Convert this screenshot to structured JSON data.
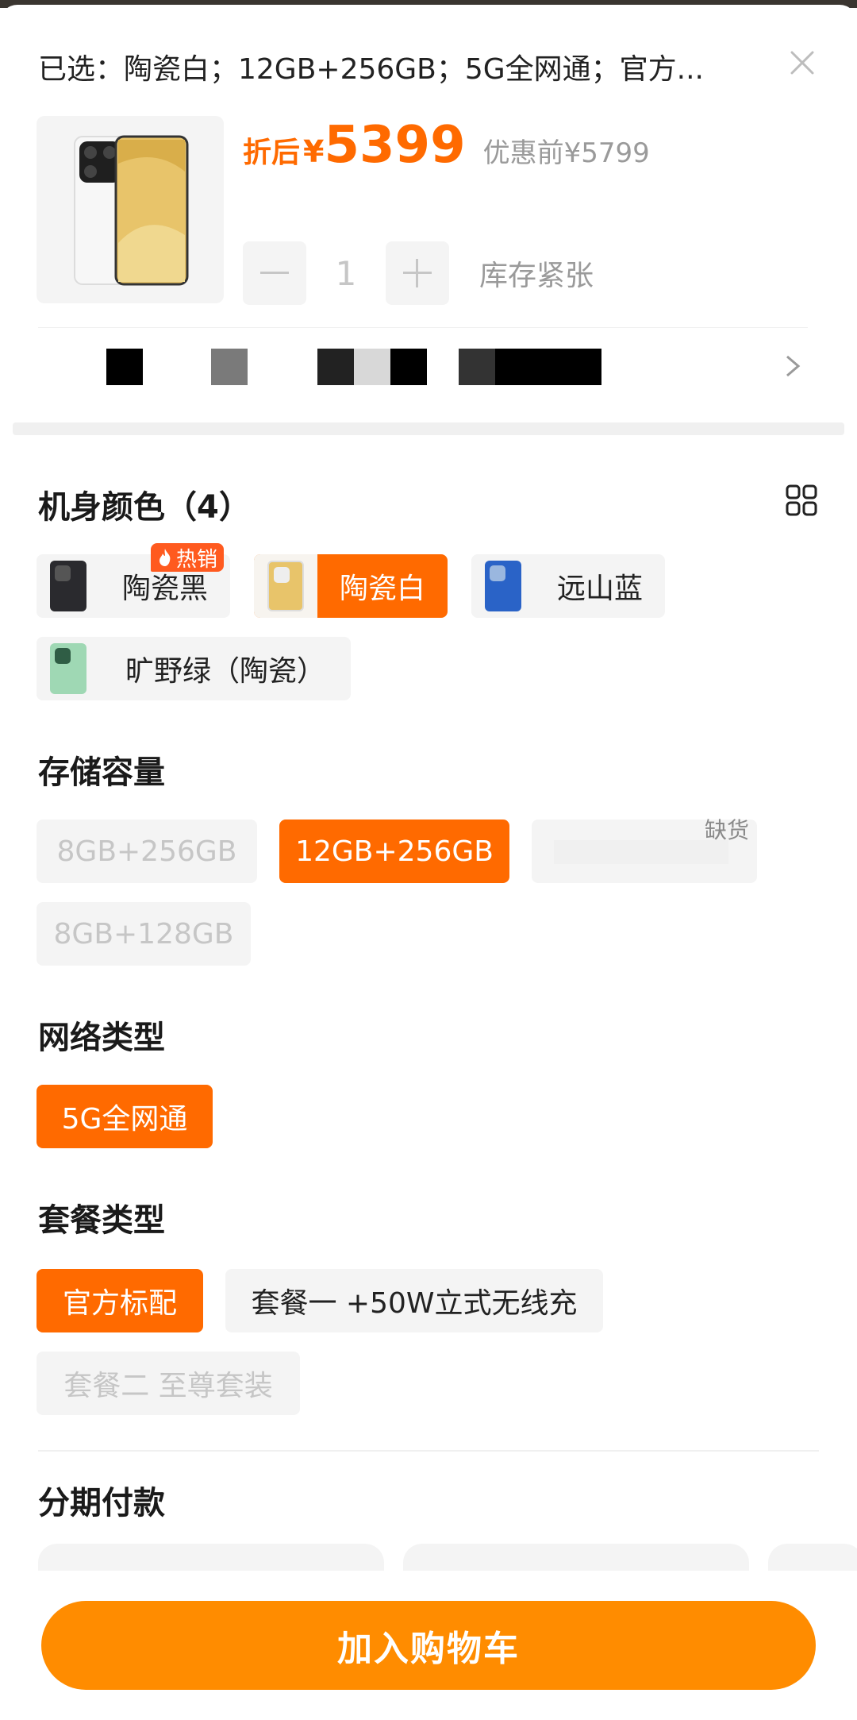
{
  "header": {
    "selected_summary": "已选：陶瓷白；12GB+256GB；5G全网通；官方..."
  },
  "price": {
    "label": "折后",
    "currency": "¥",
    "value": "5399",
    "original": "优惠前¥5799"
  },
  "quantity": {
    "minus": "—",
    "value": "1",
    "plus": "+",
    "stock_status": "库存紧张"
  },
  "sections": {
    "color": {
      "title": "机身颜色（4）",
      "options": [
        {
          "label": "陶瓷黑",
          "state": "normal",
          "badge": "热销"
        },
        {
          "label": "陶瓷白",
          "state": "selected"
        },
        {
          "label": "远山蓝",
          "state": "normal"
        },
        {
          "label": "旷野绿（陶瓷）",
          "state": "normal"
        }
      ]
    },
    "storage": {
      "title": "存储容量",
      "options": [
        {
          "label": "8GB+256GB",
          "state": "disabled"
        },
        {
          "label": "12GB+256GB",
          "state": "selected"
        },
        {
          "label": "",
          "state": "disabled",
          "tag": "缺货"
        },
        {
          "label": "8GB+128GB",
          "state": "disabled"
        }
      ]
    },
    "network": {
      "title": "网络类型",
      "options": [
        {
          "label": "5G全网通",
          "state": "selected"
        }
      ]
    },
    "package": {
      "title": "套餐类型",
      "options": [
        {
          "label": "官方标配",
          "state": "selected"
        },
        {
          "label": "套餐一 +50W立式无线充",
          "state": "normal"
        },
        {
          "label": "套餐二 至尊套装",
          "state": "disabled"
        }
      ]
    },
    "installment": {
      "title": "分期付款"
    }
  },
  "actions": {
    "add_to_cart": "加入购物车"
  },
  "colors": {
    "accent": "#ff6a00",
    "cart_button": "#ff8c00",
    "chip_bg": "#f4f4f4",
    "muted_text": "#9a9a9a"
  },
  "icons": [
    "close-icon",
    "minus-icon",
    "plus-icon",
    "chevron-right-icon",
    "grid-icon",
    "flame-icon"
  ]
}
